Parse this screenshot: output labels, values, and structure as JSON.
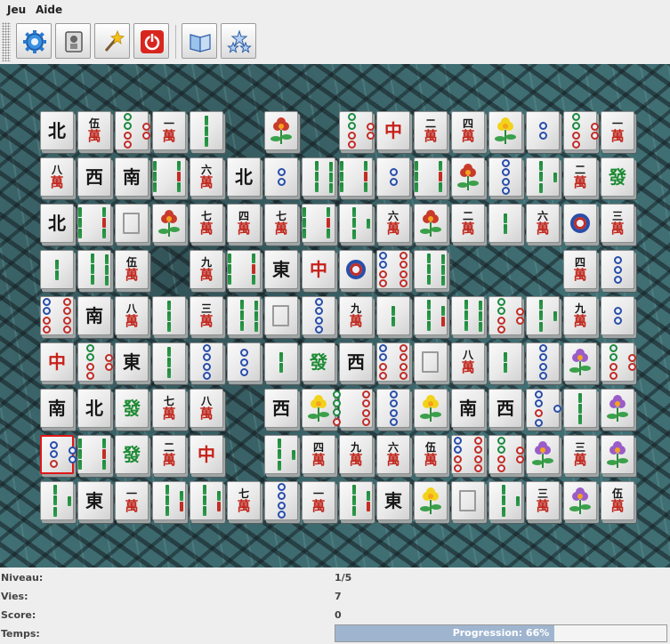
{
  "menu": {
    "items": [
      "Jeu",
      "Aide"
    ]
  },
  "toolbar": {
    "buttons": [
      {
        "name": "new-game-button",
        "icon": "gear-icon"
      },
      {
        "name": "restart-button",
        "icon": "joystick-icon"
      },
      {
        "name": "hint-button",
        "icon": "magic-wand-icon"
      },
      {
        "name": "quit-button",
        "icon": "power-icon"
      },
      {
        "name": "rules-button",
        "icon": "book-icon"
      },
      {
        "name": "about-button",
        "icon": "stars-icon"
      }
    ]
  },
  "board": {
    "rows": [
      [
        "北",
        "伍",
        "p6",
        "一",
        "s3",
        "",
        "fl",
        "",
        "p6",
        "中",
        "二",
        "四",
        "fy",
        "p2",
        "p6",
        "一"
      ],
      [
        "八",
        "西",
        "南",
        "s9",
        "六",
        "北",
        "p2",
        "s6",
        "s9",
        "p2",
        "s9",
        "fl",
        "p4",
        "s4",
        "二",
        "發"
      ],
      [
        "北",
        "s9",
        "白",
        "fl",
        "七",
        "四",
        "七",
        "s9",
        "s4",
        "六",
        "fl",
        "二",
        "s2",
        "六",
        "p1",
        "三"
      ],
      [
        "s2",
        "s6",
        "伍",
        "",
        "九",
        "s9",
        "東",
        "中",
        "p1",
        "p8",
        "s6",
        "",
        "",
        "",
        "四",
        "p3"
      ],
      [
        "p8",
        "南",
        "八",
        "s3",
        "三",
        "s6",
        "白",
        "p4",
        "九",
        "s2",
        "s5",
        "s6",
        "p6",
        "s4",
        "九",
        "p2"
      ],
      [
        "中",
        "p6",
        "東",
        "s3",
        "p4",
        "p3",
        "s2",
        "發",
        "西",
        "p8",
        "白",
        "八",
        "s2",
        "p4",
        "fp",
        "p6"
      ],
      [
        "南",
        "北",
        "發",
        "七",
        "八",
        "",
        "西",
        "fy",
        "p9",
        "p4",
        "fy",
        "南",
        "西",
        "p5",
        "s3",
        "fp"
      ],
      [
        "p5",
        "s9",
        "發",
        "二",
        "中",
        "",
        "s4",
        "四",
        "九",
        "六",
        "伍",
        "p8",
        "p6",
        "fp",
        "三",
        "fp"
      ],
      [
        "s4",
        "東",
        "一",
        "s5",
        "s5",
        "七",
        "p4",
        "一",
        "s5",
        "東",
        "fy",
        "白",
        "s4",
        "三",
        "fp",
        "伍"
      ]
    ],
    "selected": {
      "row": 7,
      "col": 0
    }
  },
  "status": {
    "level_label": "Niveau:",
    "level_value": "1/5",
    "lives_label": "Vies:",
    "lives_value": "7",
    "score_label": "Score:",
    "score_value": "0",
    "time_label": "Temps:",
    "progress_text": "Progression: 66%",
    "progress_fraction": 0.66
  }
}
